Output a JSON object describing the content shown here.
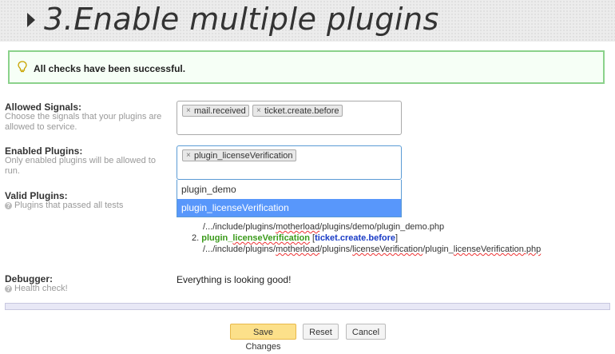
{
  "banner": {
    "title": "3.Enable multiple plugins"
  },
  "alert": {
    "text": "All checks have been successful."
  },
  "allowed_signals": {
    "label": "Allowed Signals:",
    "description": "Choose the signals that your plugins are allowed to service.",
    "tags": [
      "mail.received",
      "ticket.create.before"
    ]
  },
  "enabled_plugins": {
    "label": "Enabled Plugins:",
    "description": "Only enabled plugins will be allowed to run.",
    "tags": [
      "plugin_licenseVerification"
    ],
    "dropdown_options": [
      "plugin_demo",
      "plugin_licenseVerification"
    ],
    "highlighted_option": "plugin_licenseVerification"
  },
  "valid_plugins": {
    "label": "Valid Plugins:",
    "help": "Plugins that passed all tests",
    "items": [
      {
        "path_prefix": "/.../include/plugins/",
        "path_mid": "motherload",
        "path_suffix": "/plugins/demo/plugin_demo.php"
      },
      {
        "number": "2.",
        "name_prefix": "plugin_",
        "name_rest": "licenseVerification",
        "signal": "ticket.create.before",
        "path_prefix": "/.../include/plugins/",
        "path_mid": "motherload",
        "path_sep": "/plugins/",
        "path_dir": "licenseVerification",
        "path_file_prefix": "/plugin_",
        "path_file": "licenseVerification.php"
      }
    ]
  },
  "debugger": {
    "label": "Debugger:",
    "help": "Health check!",
    "value": "Everything is looking good!"
  },
  "buttons": {
    "save": "Save Changes",
    "reset": "Reset",
    "cancel": "Cancel"
  },
  "colors": {
    "save_button": "#fce08a",
    "success_border": "#8bd28b",
    "dropdown_highlight": "#5897fb",
    "plugin_name": "#3a9a1a",
    "signal": "#1a3cc6"
  }
}
